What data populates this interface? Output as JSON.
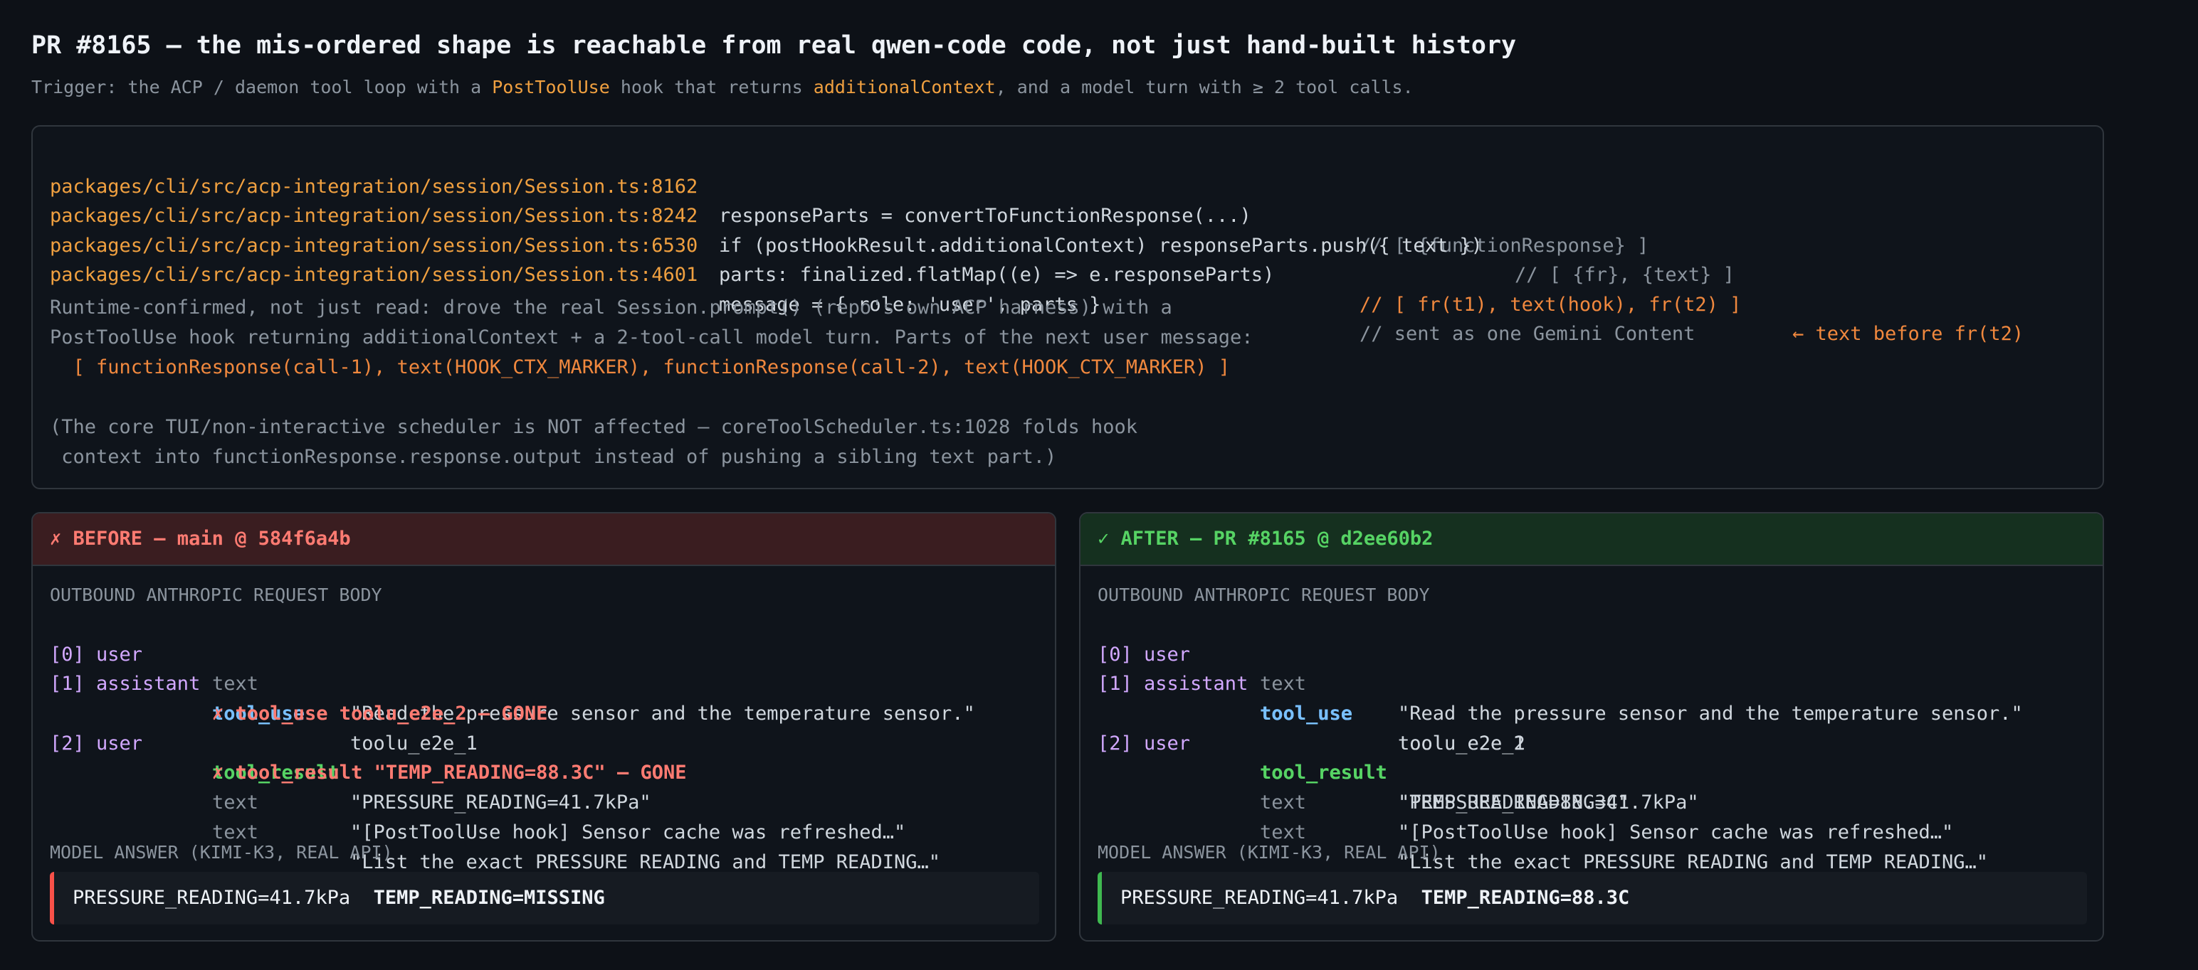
{
  "header": {
    "title": "PR #8165 — the mis-ordered shape is reachable from real qwen-code code, not just hand-built history",
    "subtitle_pre": "Trigger: the ACP / daemon tool loop with a ",
    "subtitle_hl1": "PostToolUse",
    "subtitle_mid": " hook that returns ",
    "subtitle_hl2": "additionalContext",
    "subtitle_post": ", and a model turn with ≥ 2 tool calls."
  },
  "code": {
    "lines": [
      {
        "path": "packages/cli/src/acp-integration/session/Session.ts:8162",
        "stmt": "responseParts = convertToFunctionResponse(...)",
        "comment": "// [ {functionResponse} ]"
      },
      {
        "path": "packages/cli/src/acp-integration/session/Session.ts:8242",
        "stmt": "if (postHookResult.additionalContext) responseParts.push({ text })",
        "comment": "// [ {fr}, {text} ]"
      },
      {
        "path": "packages/cli/src/acp-integration/session/Session.ts:6530",
        "stmt": "parts: finalized.flatMap((e) => e.responseParts)",
        "comment": "// [ fr(t1), text(hook), fr(t2) ]",
        "arrow": "← text before fr(t2)"
      },
      {
        "path": "packages/cli/src/acp-integration/session/Session.ts:4601",
        "stmt": "message = { role: 'user', parts }",
        "comment": "// sent as one Gemini Content"
      }
    ],
    "note1_l1": "Runtime-confirmed, not just read: drove the real Session.prompt() (repo's own ACP harness) with a",
    "note1_l2": "PostToolUse hook returning additionalContext + a 2-tool-call model turn. Parts of the next user message:",
    "note1_l3": "  [ functionResponse(call-1), text(HOOK_CTX_MARKER), functionResponse(call-2), text(HOOK_CTX_MARKER) ]",
    "note2_l1": "(The core TUI/non-interactive scheduler is NOT affected — coreToolScheduler.ts:1028 folds hook",
    "note2_l2": " context into functionResponse.response.output instead of pushing a sibling text part.)"
  },
  "before": {
    "header": "✗ BEFORE — main @ 584f6a4b",
    "section_label": "OUTBOUND ANTHROPIC REQUEST BODY",
    "rows": {
      "r0": {
        "idx": "[0] user",
        "type": "text",
        "val": "\"Read the pressure sensor and the temperature sensor.\""
      },
      "r1": {
        "idx": "[1] assistant",
        "type": "tool_use",
        "val": "toolu_e2e_1"
      },
      "r2": {
        "gone": "✗ tool_use toolu_e2e_2 — GONE"
      },
      "r3": {
        "idx": "[2] user",
        "type": "tool_result",
        "val": "\"PRESSURE_READING=41.7kPa\""
      },
      "r4": {
        "gone": "✗ tool_result \"TEMP_READING=88.3C\" — GONE"
      },
      "r5": {
        "type": "text",
        "val": "\"[PostToolUse hook] Sensor cache was refreshed…\""
      },
      "r6": {
        "type": "text",
        "val": "\"List the exact PRESSURE_READING and TEMP_READING…\""
      }
    },
    "answer_label": "MODEL ANSWER (KIMI-K3, REAL API)",
    "answer_a": "PRESSURE_READING=41.7kPa",
    "answer_b": "TEMP_READING=MISSING",
    "accent": "#f85149"
  },
  "after": {
    "header": "✓ AFTER — PR #8165 @ d2ee60b2",
    "section_label": "OUTBOUND ANTHROPIC REQUEST BODY",
    "rows": {
      "r0": {
        "idx": "[0] user",
        "type": "text",
        "val": "\"Read the pressure sensor and the temperature sensor.\""
      },
      "r1": {
        "idx": "[1] assistant",
        "type": "tool_use",
        "val": "toolu_e2e_1"
      },
      "r2": {
        "type": "tool_use",
        "val": "toolu_e2e_2"
      },
      "r3": {
        "idx": "[2] user",
        "type": "tool_result",
        "val": "\"PRESSURE_READING=41.7kPa\""
      },
      "r4": {
        "type": "tool_result",
        "val": "\"TEMP_READING=88.3C\""
      },
      "r5": {
        "type": "text",
        "val": "\"[PostToolUse hook] Sensor cache was refreshed…\""
      },
      "r6": {
        "type": "text",
        "val": "\"List the exact PRESSURE_READING and TEMP_READING…\""
      }
    },
    "answer_label": "MODEL ANSWER (KIMI-K3, REAL API)",
    "answer_a": "PRESSURE_READING=41.7kPa",
    "answer_b": "TEMP_READING=88.3C",
    "accent": "#3fb950"
  }
}
